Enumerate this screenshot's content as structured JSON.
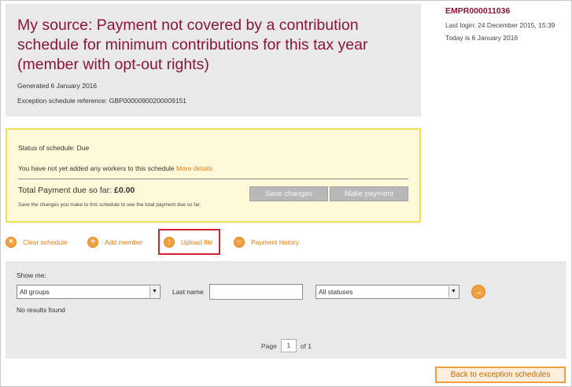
{
  "header": {
    "title": "My source: Payment not covered by a contribution schedule for minimum contributions for this tax year (member with opt-out rights)",
    "generated": "Generated 6 January 2016",
    "exception_ref": "Exception schedule reference: GBP00000900200009151"
  },
  "account": {
    "employer_ref": "EMPR000011036",
    "last_login": "Last login: 24 December 2015, 15:39",
    "today": "Today is 6 January 2016"
  },
  "status_panel": {
    "status": "Status of schedule: Due",
    "workers_msg": "You have not yet added any workers to this schedule",
    "more_details": "More details",
    "total_label": "Total Payment due so far:",
    "total_value": "£0.00",
    "save_note": "Save the changes you make to this schedule to see the total payment due so far.",
    "save_button": "Save changes",
    "payment_button": "Make payment"
  },
  "actions": {
    "clear": "Clear schedule",
    "add": "Add member",
    "upload": "Upload file",
    "history": "Payment history"
  },
  "filter": {
    "show_me": "Show me:",
    "groups_value": "All groups",
    "last_name_label": "Last name",
    "last_name_value": "",
    "statuses_value": "All statuses",
    "no_results": "No results found"
  },
  "pagination": {
    "page_label": "Page",
    "current": "1",
    "of_label": "of 1"
  },
  "footer": {
    "back_button": "Back to exception schedules"
  },
  "colors": {
    "title": "#8b1538",
    "accent": "#e07a10",
    "highlight": "#d6202e",
    "status_bg": "#fefad9",
    "status_border": "#f2dd55"
  },
  "icons": {
    "clear": "close-icon",
    "add": "plus-icon",
    "upload": "upload-icon",
    "history": "search-icon",
    "go": "arrow-right-icon",
    "dropdown": "chevron-down-icon"
  }
}
